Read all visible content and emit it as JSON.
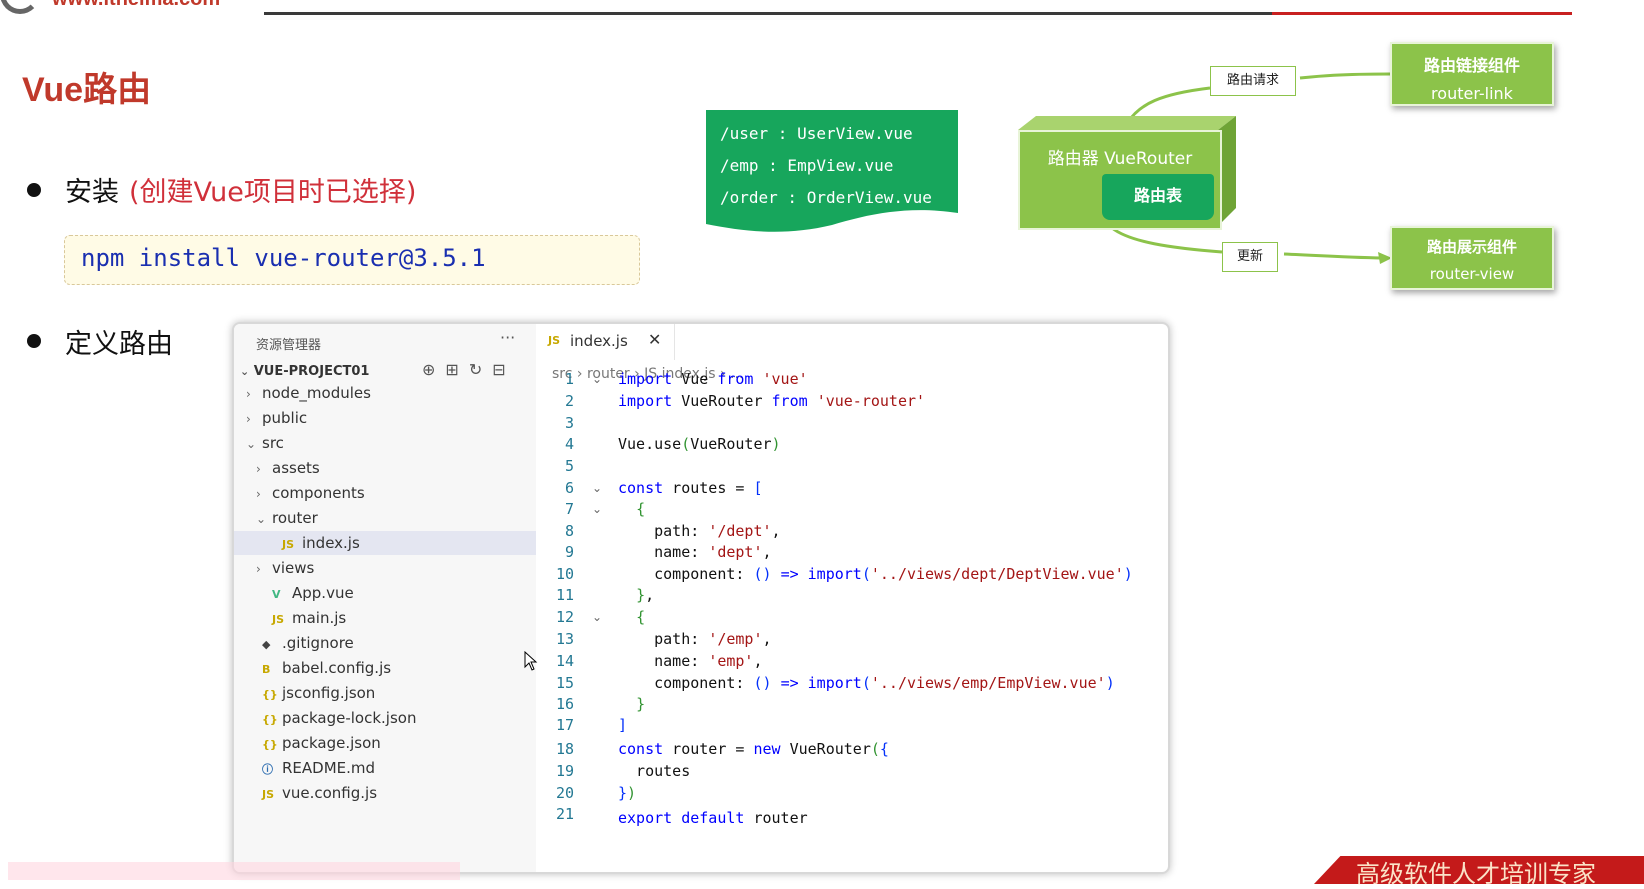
{
  "header": {
    "logo_text": "www.itheima.com"
  },
  "slide": {
    "title": "Vue路由",
    "bullet1": "安装",
    "bullet1_note": "(创建Vue项目时已选择)",
    "install_command": "npm install vue-router@3.5.1",
    "bullet2": "定义路由"
  },
  "route_table": {
    "lines": [
      "/user : UserView.vue",
      "/emp : EmpView.vue",
      "/order : OrderView.vue"
    ],
    "fill_color": "#17a65c"
  },
  "diagram": {
    "router_link_title": "路由链接组件",
    "router_link_sub": "router-link",
    "request_label": "路由请求",
    "router_title": "路由器 VueRouter",
    "router_table": "路由表",
    "update_label": "更新",
    "router_view_title": "路由展示组件",
    "router_view_sub": "router-view",
    "box_color": "#8cc34a"
  },
  "explorer": {
    "header": "资源管理器",
    "more": "···",
    "project": "VUE-PROJECT01",
    "tree": [
      {
        "chev": "›",
        "icon": "",
        "label": "node_modules"
      },
      {
        "chev": "›",
        "icon": "",
        "label": "public"
      },
      {
        "chev": "⌄",
        "icon": "",
        "label": "src"
      },
      {
        "chev": "›",
        "icon": "",
        "label": "assets"
      },
      {
        "chev": "›",
        "icon": "",
        "label": "components"
      },
      {
        "chev": "⌄",
        "icon": "",
        "label": "router"
      },
      {
        "chev": "",
        "icon": "JS",
        "label": "index.js"
      },
      {
        "chev": "›",
        "icon": "",
        "label": "views"
      },
      {
        "chev": "",
        "icon": "V",
        "label": "App.vue"
      },
      {
        "chev": "",
        "icon": "JS",
        "label": "main.js"
      },
      {
        "chev": "",
        "icon": "◆",
        "label": ".gitignore"
      },
      {
        "chev": "",
        "icon": "B",
        "label": "babel.config.js"
      },
      {
        "chev": "",
        "icon": "{}",
        "label": "jsconfig.json"
      },
      {
        "chev": "",
        "icon": "{}",
        "label": "package-lock.json"
      },
      {
        "chev": "",
        "icon": "{}",
        "label": "package.json"
      },
      {
        "chev": "",
        "icon": "ⓘ",
        "label": "README.md"
      },
      {
        "chev": "",
        "icon": "JS",
        "label": "vue.config.js"
      }
    ]
  },
  "editor": {
    "tab_icon": "JS",
    "tab_name": "index.js",
    "tab_close": "✕",
    "breadcrumb": "src › router › JS index.js › ...",
    "line_numbers": [
      "1",
      "2",
      "3",
      "4",
      "5",
      "6",
      "7",
      "8",
      "9",
      "10",
      "11",
      "12",
      "13",
      "14",
      "15",
      "16",
      "17",
      "18",
      "19",
      "20",
      "21"
    ]
  },
  "footer": {
    "slogan": "高级软件人才培训专家"
  }
}
